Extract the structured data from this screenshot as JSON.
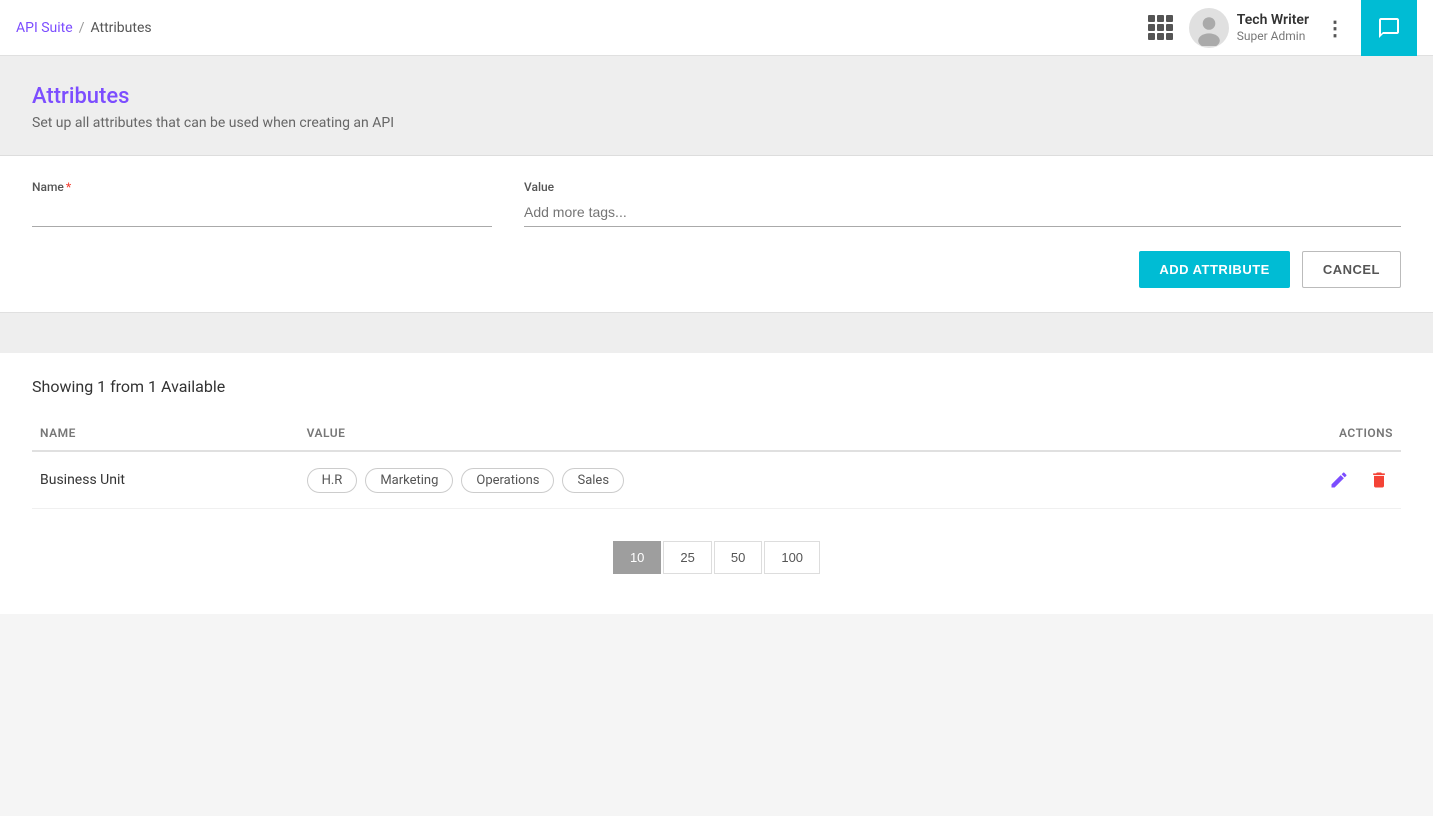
{
  "nav": {
    "breadcrumb_parent": "API Suite",
    "breadcrumb_separator": "/",
    "breadcrumb_current": "Attributes"
  },
  "user": {
    "name": "Tech Writer",
    "role": "Super Admin"
  },
  "header": {
    "title": "Attributes",
    "subtitle": "Set up all attributes that can be used when creating an API"
  },
  "form": {
    "name_label": "Name",
    "name_placeholder": "",
    "value_label": "Value",
    "value_placeholder": "Add more tags...",
    "add_button_label": "ADD ATTRIBUTE",
    "cancel_button_label": "CANCEL"
  },
  "table": {
    "showing_text": "Showing 1 from 1 Available",
    "columns": {
      "name": "NAME",
      "value": "VALUE",
      "actions": "ACTIONS"
    },
    "rows": [
      {
        "name": "Business Unit",
        "tags": [
          "H.R",
          "Marketing",
          "Operations",
          "Sales"
        ]
      }
    ]
  },
  "pagination": {
    "options": [
      "10",
      "25",
      "50",
      "100"
    ],
    "active": "10"
  }
}
